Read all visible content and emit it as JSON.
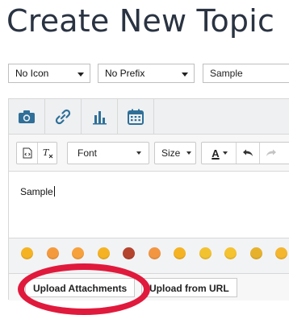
{
  "page": {
    "title": "Create New Topic"
  },
  "selectors": {
    "icon": {
      "value": "No Icon"
    },
    "prefix": {
      "value": "No Prefix"
    }
  },
  "title_input": {
    "value": "Sample"
  },
  "media_toolbar": {
    "buttons": [
      {
        "icon": "camera-icon"
      },
      {
        "icon": "link-icon"
      },
      {
        "icon": "poll-chart-icon"
      },
      {
        "icon": "calendar-icon"
      }
    ]
  },
  "format_toolbar": {
    "font_label": "Font",
    "size_label": "Size",
    "text_color_label": "A"
  },
  "editor": {
    "content": "Sample"
  },
  "emoji_bar": {
    "colors": [
      "#f5b323",
      "#f59a3c",
      "#f7a13c",
      "#f5b323",
      "#b5442f",
      "#f29642",
      "#f5b323",
      "#f2c230",
      "#f5c230",
      "#e6b22d",
      "#f4b62e"
    ]
  },
  "attachments": {
    "upload_attachments_label": "Upload Attachments",
    "upload_url_label": "Upload from URL"
  },
  "colors": {
    "highlight": "#e01a3c",
    "title": "#2a3342",
    "toolbar_icon": "#2f6f98"
  }
}
